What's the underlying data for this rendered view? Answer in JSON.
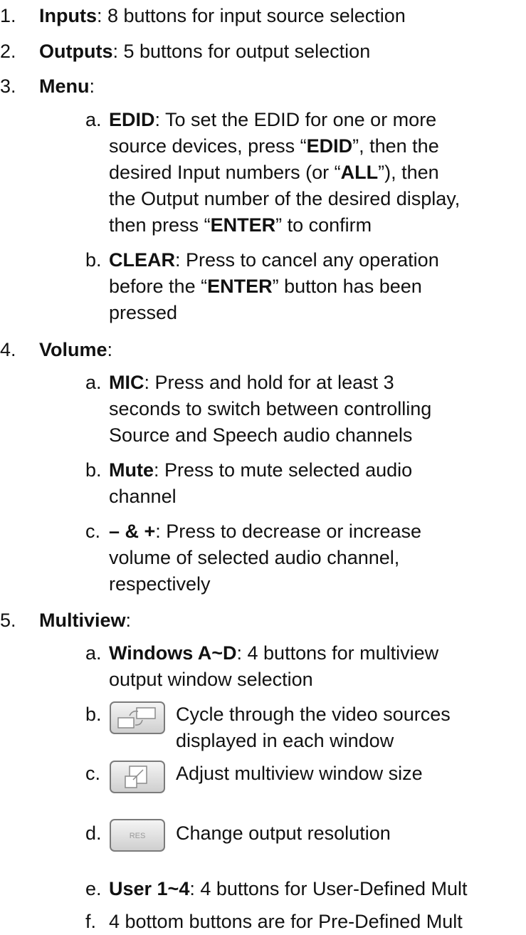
{
  "items": [
    {
      "num": "1.",
      "bold": "Inputs",
      "rest": ": 8 buttons for input source selection"
    },
    {
      "num": "2.",
      "bold": "Outputs",
      "rest": ": 5 buttons for output selection"
    },
    {
      "num": "3.",
      "bold": "Menu",
      "rest": ":"
    },
    {
      "num": "4.",
      "bold": "Volume",
      "rest": ":"
    },
    {
      "num": "5.",
      "bold": "Multiview",
      "rest": ":"
    }
  ],
  "menu": {
    "edid": {
      "letter": "a.",
      "l1_bold": "EDID",
      "l1_rest": ": To set the EDID for one or more",
      "l2_a": "source devices, press “",
      "l2_bold": "EDID",
      "l2_c": "”, then the",
      "l3_a": "desired Input numbers (or “",
      "l3_bold": "ALL",
      "l3_c": "”), then",
      "l4": "the Output number of the desired display,",
      "l5_a": "then press “",
      "l5_bold": "ENTER",
      "l5_c": "” to confirm"
    },
    "clear": {
      "letter": "b.",
      "l1_bold": "CLEAR",
      "l1_rest": ": Press to cancel any operation",
      "l2_a": "before the “",
      "l2_bold": "ENTER",
      "l2_c": "” button has been",
      "l3": "pressed"
    }
  },
  "volume": {
    "mic": {
      "letter": "a.",
      "l1_bold": "MIC",
      "l1_rest": ": Press and hold for at least 3",
      "l2": "seconds to switch between controlling",
      "l3": "Source and Speech audio channels"
    },
    "mute": {
      "letter": "b.",
      "l1_bold": "Mute",
      "l1_rest": ": Press to mute selected audio",
      "l2": "channel"
    },
    "plusminus": {
      "letter": "c.",
      "l1_bold": "– & +",
      "l1_rest": ": Press to decrease or increase",
      "l2": "volume of selected audio channel,",
      "l3": "respectively"
    }
  },
  "multiview": {
    "windows": {
      "letter": "a.",
      "l1_bold": "Windows A~D",
      "l1_rest": ": 4 buttons for multiview",
      "l2": "output window selection"
    },
    "cycle": {
      "letter": "b.",
      "icon": "cycle-sources-icon",
      "l1": "Cycle through the video sources",
      "l2": "displayed in each window"
    },
    "size": {
      "letter": "c.",
      "icon": "window-size-icon",
      "l1": "Adjust multiview window size"
    },
    "res": {
      "letter": "d.",
      "icon": "resolution-icon",
      "icon_text": "RES",
      "l1": "Change output resolution"
    },
    "user": {
      "letter": "e.",
      "l1_bold": "User 1~4",
      "l1_rest": ": 4 buttons for User-Defined Mult"
    },
    "bottom": {
      "letter": "f.",
      "l1": "4 bottom buttons are for Pre-Defined Mult"
    }
  }
}
